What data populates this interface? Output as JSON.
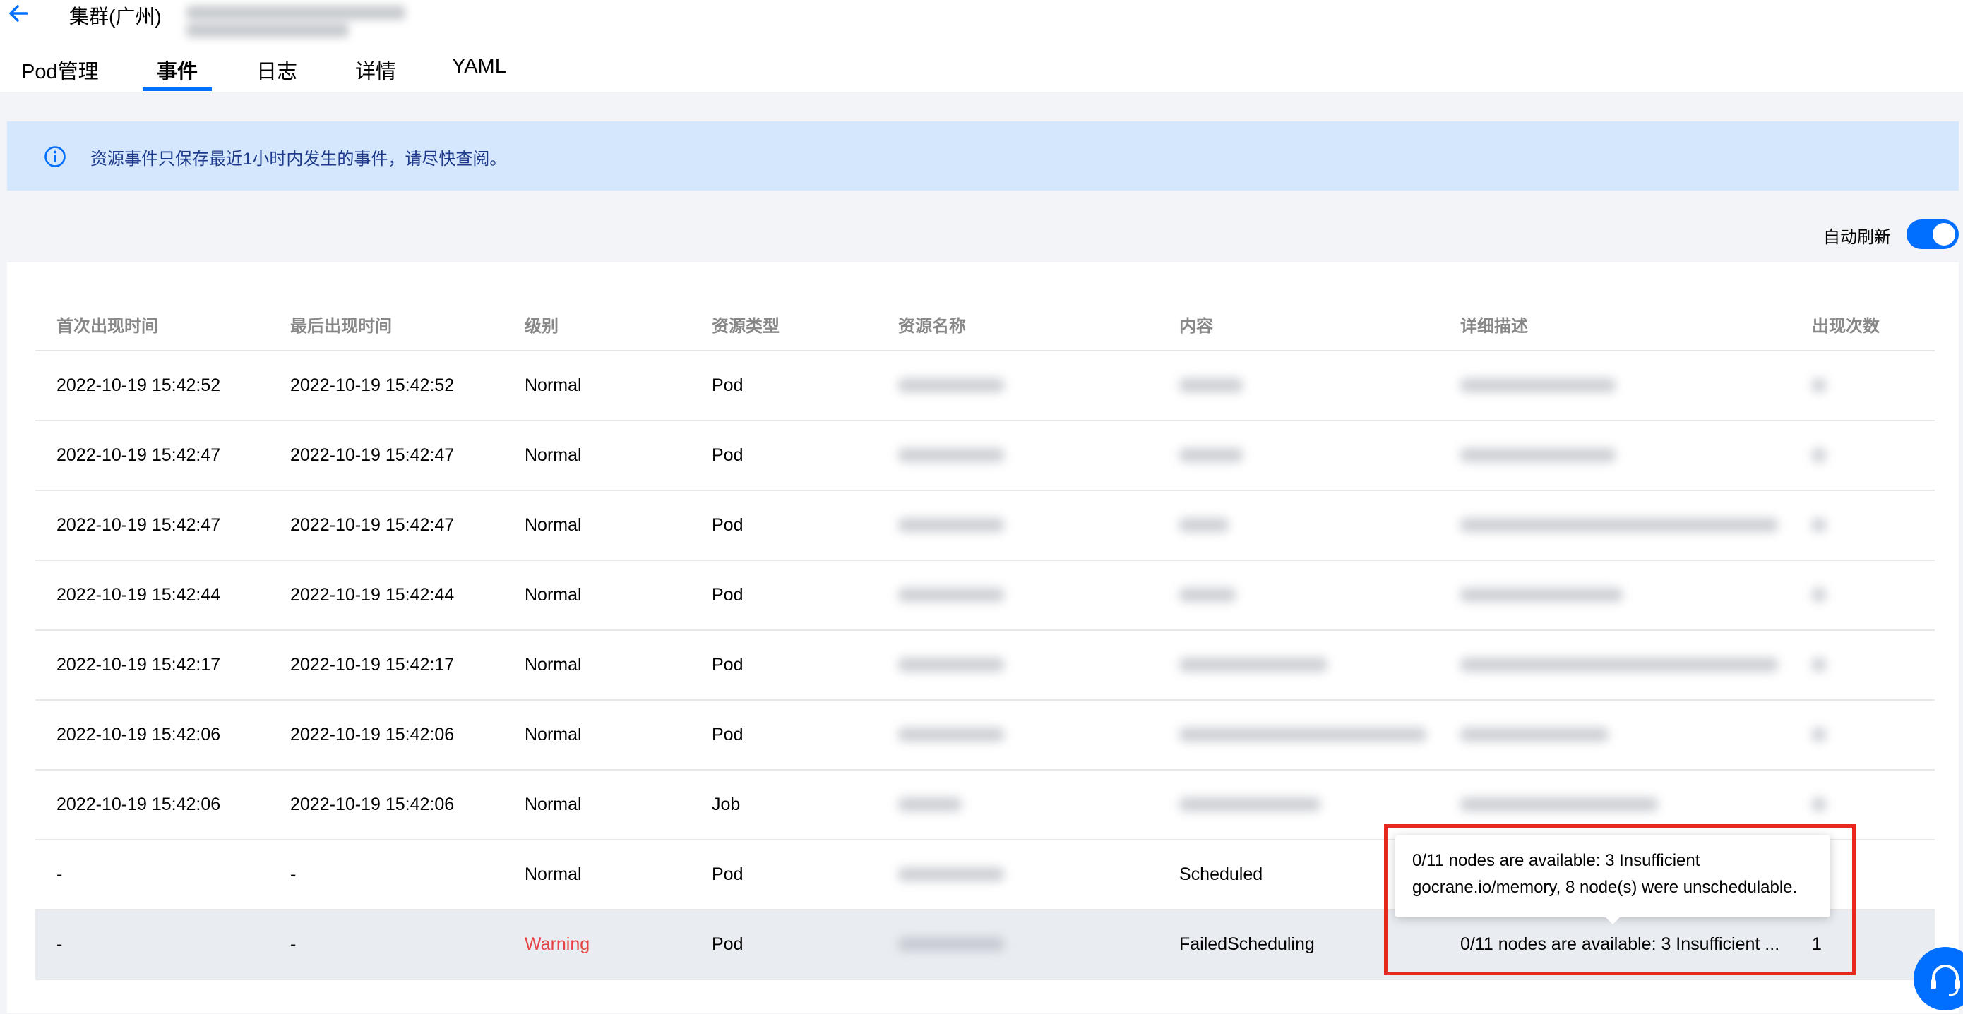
{
  "header": {
    "cluster_label": "集群(广州)",
    "tabs": [
      {
        "label": "Pod管理",
        "active": false
      },
      {
        "label": "事件",
        "active": true
      },
      {
        "label": "日志",
        "active": false
      },
      {
        "label": "详情",
        "active": false
      },
      {
        "label": "YAML",
        "active": false
      }
    ]
  },
  "notice": {
    "text": "资源事件只保存最近1小时内发生的事件，请尽快查阅。",
    "icon": "info-icon"
  },
  "auto_refresh": {
    "label": "自动刷新",
    "enabled": true
  },
  "table": {
    "columns": [
      "首次出现时间",
      "最后出现时间",
      "级别",
      "资源类型",
      "资源名称",
      "内容",
      "详细描述",
      "出现次数"
    ],
    "rows": [
      {
        "first": "2022-10-19 15:42:52",
        "last": "2022-10-19 15:42:52",
        "level": "Normal",
        "type": "Pod",
        "content": "",
        "detail": "",
        "count": ""
      },
      {
        "first": "2022-10-19 15:42:47",
        "last": "2022-10-19 15:42:47",
        "level": "Normal",
        "type": "Pod",
        "content": "",
        "detail": "",
        "count": ""
      },
      {
        "first": "2022-10-19 15:42:47",
        "last": "2022-10-19 15:42:47",
        "level": "Normal",
        "type": "Pod",
        "content": "",
        "detail": "",
        "count": ""
      },
      {
        "first": "2022-10-19 15:42:44",
        "last": "2022-10-19 15:42:44",
        "level": "Normal",
        "type": "Pod",
        "content": "",
        "detail": "",
        "count": ""
      },
      {
        "first": "2022-10-19 15:42:17",
        "last": "2022-10-19 15:42:17",
        "level": "Normal",
        "type": "Pod",
        "content": "",
        "detail": "",
        "count": ""
      },
      {
        "first": "2022-10-19 15:42:06",
        "last": "2022-10-19 15:42:06",
        "level": "Normal",
        "type": "Pod",
        "content": "",
        "detail": "",
        "count": ""
      },
      {
        "first": "2022-10-19 15:42:06",
        "last": "2022-10-19 15:42:06",
        "level": "Normal",
        "type": "Job",
        "content": "",
        "detail": "",
        "count": ""
      },
      {
        "first": "-",
        "last": "-",
        "level": "Normal",
        "type": "Pod",
        "content": "Scheduled",
        "detail": "",
        "count": ""
      },
      {
        "first": "-",
        "last": "-",
        "level": "Warning",
        "type": "Pod",
        "content": "FailedScheduling",
        "detail": "0/11 nodes are available: 3 Insufficient ...",
        "count": "1"
      }
    ]
  },
  "tooltip": {
    "line1": "0/11 nodes are available: 3 Insufficient",
    "line2": "gocrane.io/memory, 8 node(s) were unschedulable."
  },
  "colors": {
    "accent": "#006eff",
    "warning": "#e54545",
    "notice_bg": "#d5e7fd",
    "highlight_box": "#e6281e"
  }
}
